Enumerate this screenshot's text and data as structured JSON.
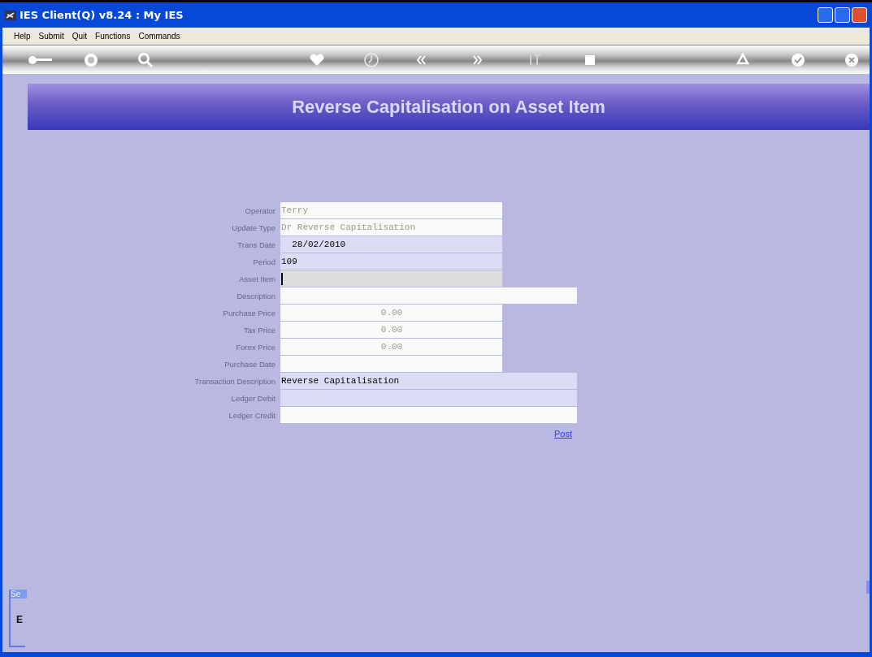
{
  "window": {
    "title": "IES Client(Q) v8.24 : My IES"
  },
  "menu": [
    "Help",
    "Submit",
    "Quit",
    "Functions",
    "Commands"
  ],
  "page_title": "Reverse Capitalisation on Asset Item",
  "fields": [
    {
      "label": "Operator",
      "value": "Terry",
      "wide": false,
      "color": "#fafafa",
      "disabled": true,
      "numeric": false
    },
    {
      "label": "Update Type",
      "value": "Dr Reverse Capitalisation",
      "wide": false,
      "color": "#fafafa",
      "disabled": true,
      "numeric": false
    },
    {
      "label": "Trans Date",
      "value": "  28/02/2010",
      "wide": false,
      "color": "#dcdcf4",
      "disabled": false,
      "numeric": false
    },
    {
      "label": "Period",
      "value": "109",
      "wide": false,
      "color": "#dcdcf4",
      "disabled": false,
      "numeric": false
    },
    {
      "label": "Asset Item",
      "wide": false,
      "color": "#dcdcdc",
      "focused": true
    },
    {
      "label": "Description",
      "wide": true,
      "color": "#fafafa"
    },
    {
      "label": "Purchase Price",
      "value": "0.00",
      "wide": false,
      "color": "#fafafa",
      "disabled": true,
      "numeric": true
    },
    {
      "label": "Tax Price",
      "value": "0.00",
      "wide": false,
      "color": "#fafafa",
      "disabled": true,
      "numeric": true
    },
    {
      "label": "Forex Price",
      "value": "0.00",
      "wide": false,
      "color": "#fafafa",
      "disabled": true,
      "numeric": true
    },
    {
      "label": "Purchase Date",
      "wide": false,
      "color": "#fafafa"
    },
    {
      "label": "Transaction Description",
      "value": "Reverse Capitalisation",
      "wide": true,
      "color": "#dcdcf4",
      "disabled": false,
      "numeric": false
    },
    {
      "label": "Ledger Debit",
      "wide": true,
      "color": "#dcdcf4"
    },
    {
      "label": "Ledger Credit",
      "wide": true,
      "color": "#fafafa"
    }
  ],
  "post_link": "Post",
  "side_panel": {
    "tab": "Se",
    "glyph": "E"
  }
}
